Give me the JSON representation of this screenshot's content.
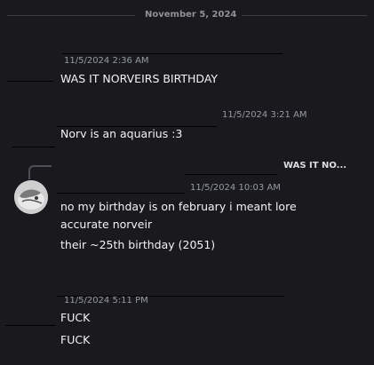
{
  "chat": {
    "date_divider": "November 5, 2024",
    "messages": [
      {
        "timestamp": "11/5/2024 2:36 AM",
        "lines": [
          "WAS IT NORVEIRS BIRTHDAY"
        ]
      },
      {
        "timestamp": "11/5/2024 3:21 AM",
        "lines": [
          "Norv is an aquarius :3"
        ]
      },
      {
        "reply_preview": "WAS IT NO...",
        "timestamp": "11/5/2024 10:03 AM",
        "lines": [
          "no my birthday is on february i meant lore",
          "accurate norveir",
          "their ~25th birthday (2051)"
        ]
      },
      {
        "timestamp": "11/5/2024 5:11 PM",
        "lines": [
          "FUCK",
          "FUCK"
        ]
      }
    ]
  }
}
